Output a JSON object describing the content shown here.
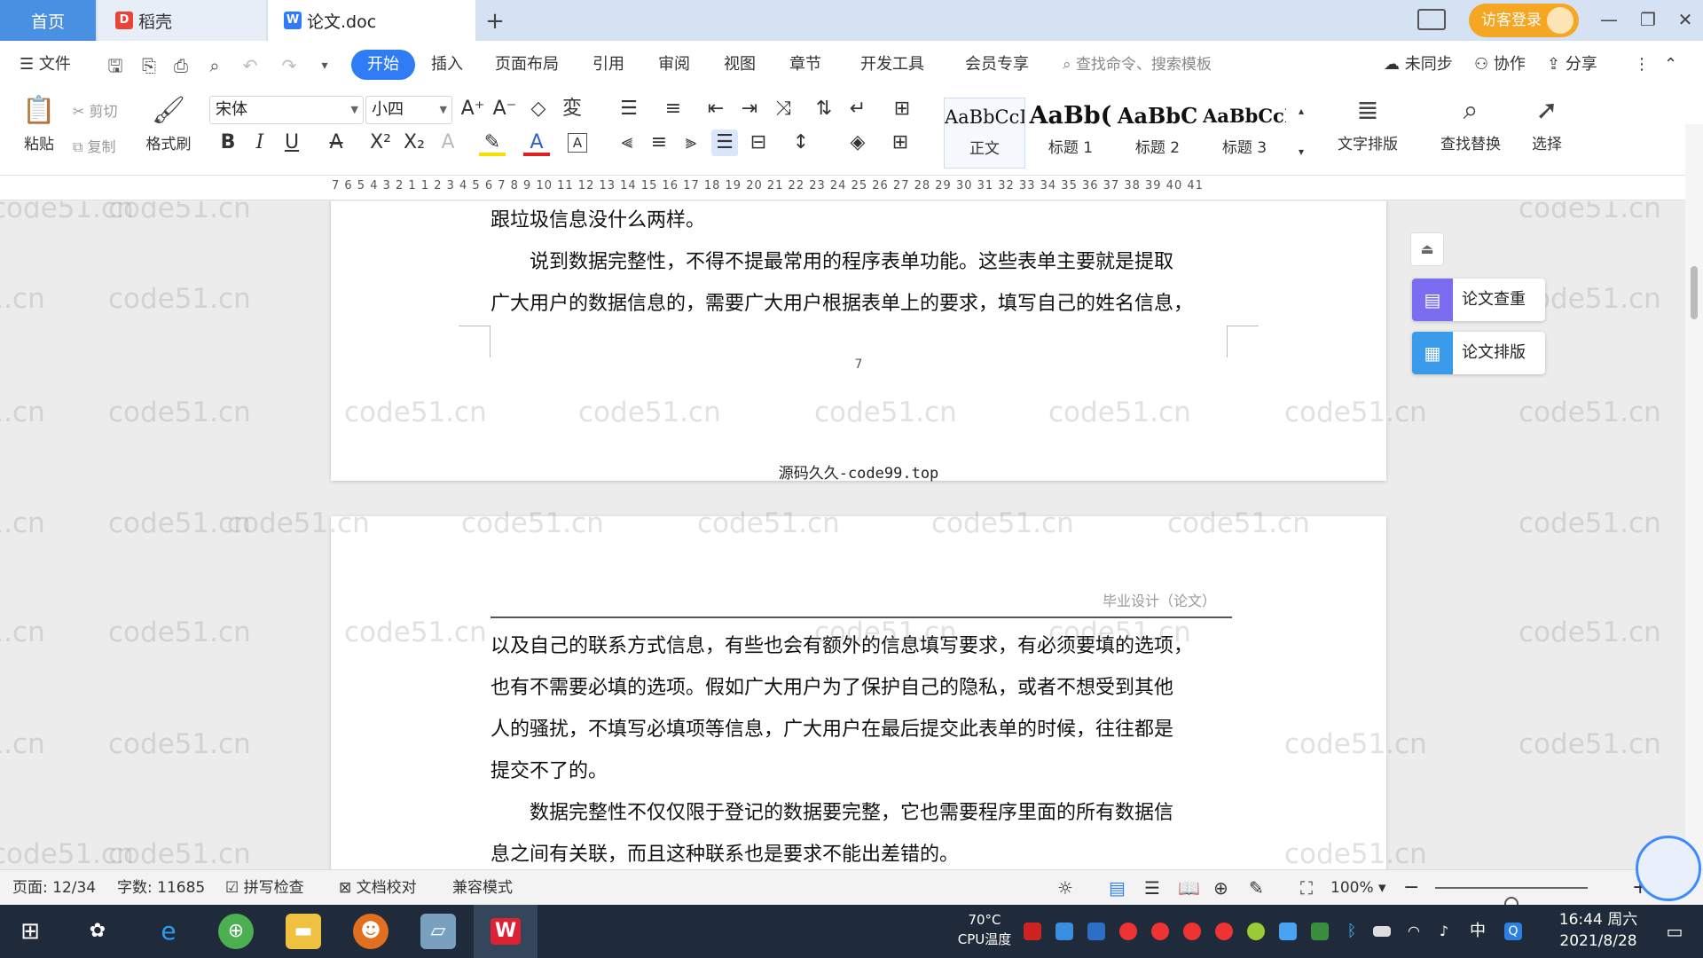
{
  "tabs": {
    "home": "首页",
    "daoke": "稻壳",
    "doc": "论文.doc",
    "add": "+"
  },
  "titlebar": {
    "login": "访客登录"
  },
  "menu": {
    "file": "文件",
    "items": [
      "开始",
      "插入",
      "页面布局",
      "引用",
      "审阅",
      "视图",
      "章节",
      "开发工具",
      "会员专享"
    ],
    "search_placeholder": "查找命令、搜索模板",
    "unsynced": "未同步",
    "collab": "协作",
    "share": "分享"
  },
  "ribbon": {
    "paste": "粘贴",
    "cut": "剪切",
    "copy": "复制",
    "format_painter": "格式刷",
    "font_name": "宋体",
    "font_size": "小四",
    "styles": [
      {
        "sample": "AaBbCcI",
        "name": "正文"
      },
      {
        "sample": "AaBb(",
        "name": "标题 1"
      },
      {
        "sample": "AaBbC",
        "name": "标题 2"
      },
      {
        "sample": "AaBbCcI",
        "name": "标题 3"
      }
    ],
    "text_layout": "文字排版",
    "find_replace": "查找替换",
    "select": "选择"
  },
  "ruler": {
    "ticks": "7 6 5 4 3 2 1 1 2 3 4 5 6 7 8 9 10 11 12 13 14 15 16 17 18 19 20 21 22 23 24 25 26 27 28 29 30 31 32 33 34 35 36 37 38 39 40 41"
  },
  "document": {
    "page1": {
      "lines": [
        "跟垃圾信息没什么两样。",
        "　　说到数据完整性，不得不提最常用的程序表单功能。这些表单主要就是提取",
        "广大用户的数据信息的，需要广大用户根据表单上的要求，填写自己的姓名信息，"
      ],
      "page_number": "7",
      "footer": "源码久久-code99.top"
    },
    "page2": {
      "header": "毕业设计（论文）",
      "lines": [
        "以及自己的联系方式信息，有些也会有额外的信息填写要求，有必须要填的选项，",
        "也有不需要必填的选项。假如广大用户为了保护自己的隐私，或者不想受到其他",
        "人的骚扰，不填写必填项等信息，广大用户在最后提交此表单的时候，往往都是",
        "提交不了的。",
        "　　数据完整性不仅仅限于登记的数据要完整，它也需要程序里面的所有数据信",
        "息之间有关联，而且这种联系也是要求不能出差错的。"
      ]
    }
  },
  "side_panel": {
    "check": "论文查重",
    "layout": "论文排版"
  },
  "watermark": "code51.cn",
  "statusbar": {
    "page": "页面: 12/34",
    "words": "字数: 11685",
    "spell": "拼写检查",
    "proof": "文档校对",
    "compat": "兼容模式",
    "zoom": "100%",
    "zoom_level": 0.5
  },
  "taskbar": {
    "cpu_temp": "70°C",
    "cpu_label": "CPU温度",
    "ime": "中",
    "time": "16:44 周六",
    "date": "2021/8/28"
  },
  "colors": {
    "accent": "#2f7cf6",
    "home_tab": "#4a90e2",
    "login": "#f5a623",
    "side_check": "#7b6df0",
    "side_layout": "#3a9bea",
    "taskbar": "#1f2a3a"
  }
}
